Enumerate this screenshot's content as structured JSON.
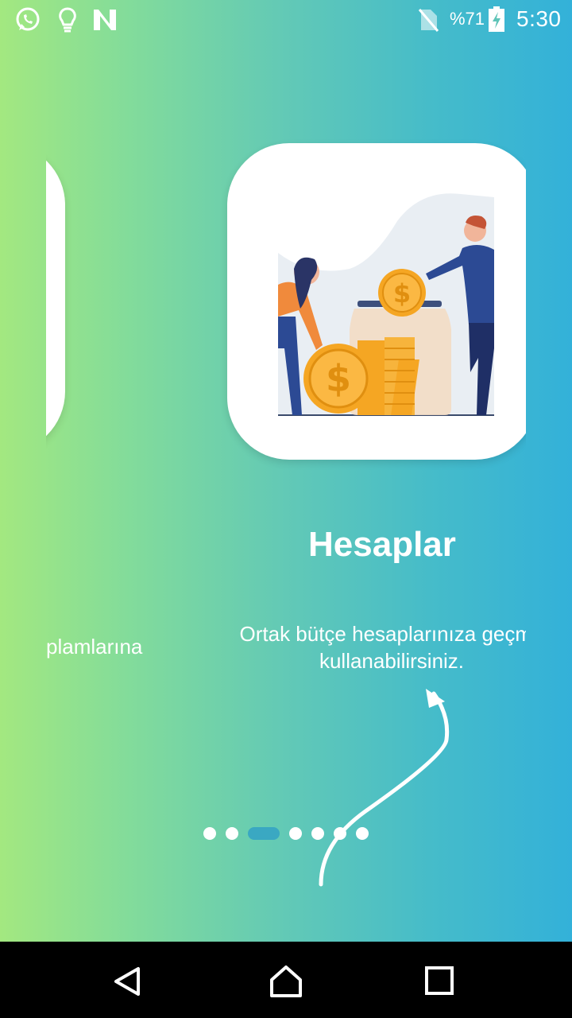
{
  "status_bar": {
    "left_icons": [
      "whatsapp-icon",
      "lightbulb-icon",
      "n-app-icon"
    ],
    "right_icons": [
      "no-sim-icon",
      "battery-charging-icon"
    ],
    "battery": "%71",
    "time": "5:30"
  },
  "carousel": {
    "previous_slide": {
      "description_fragment": "plamlarına"
    },
    "current_slide": {
      "title": "Hesaplar",
      "description": "Ortak bütçe hesaplarınıza geçme\nkullanabilirsiniz.",
      "illustration": "saving-coins-jar-illustration"
    },
    "pager": {
      "total": 7,
      "active_index": 2
    }
  },
  "nav_bar": {
    "buttons": [
      "back-icon",
      "home-icon",
      "recents-icon"
    ]
  },
  "colors": {
    "gradient_start": "#a3e880",
    "gradient_end": "#33b1d9",
    "active_dot": "#3aa8c2",
    "coin": "#f5a623"
  }
}
